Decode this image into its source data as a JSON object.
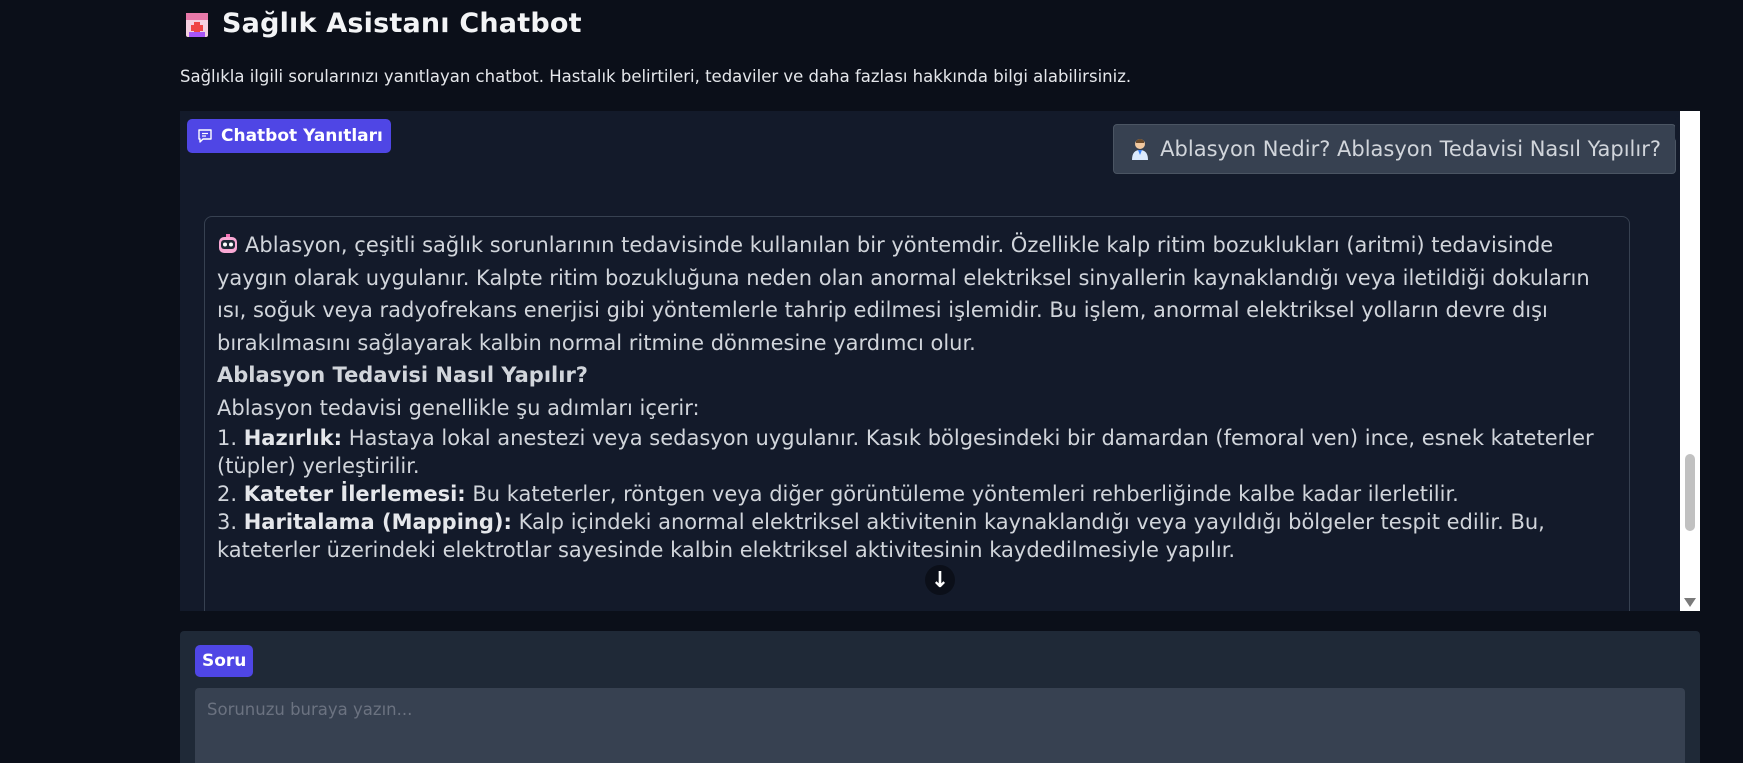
{
  "header": {
    "title_icon": "hospital-icon",
    "title": "Sağlık Asistanı Chatbot",
    "description": "Sağlıkla ilgili sorularınızı yanıtlayan chatbot. Hastalık belirtileri, tedaviler ve daha fazlası hakkında bilgi alabilirsiniz."
  },
  "chat": {
    "label": "Chatbot Yanıtları",
    "label_icon": "chat-icon",
    "clear_icon": "trash-icon",
    "user_message": {
      "avatar_icon": "doctor-icon",
      "text": "Ablasyon Nedir? Ablasyon Tedavisi Nasıl Yapılır?"
    },
    "bot_message": {
      "avatar_icon": "robot-icon",
      "paragraph1": "Ablasyon, çeşitli sağlık sorunlarının tedavisinde kullanılan bir yöntemdir. Özellikle kalp ritim bozuklukları (aritmi) tedavisinde yaygın olarak uygulanır. Kalpte ritim bozukluğuna neden olan anormal elektriksel sinyallerin kaynaklandığı veya iletildiği dokuların ısı, soğuk veya radyofrekans enerjisi gibi yöntemlerle tahrip edilmesi işlemidir. Bu işlem, anormal elektriksel yolların devre dışı bırakılmasını sağlayarak kalbin normal ritmine dönmesine yardımcı olur.",
      "heading": "Ablasyon Tedavisi Nasıl Yapılır?",
      "intro": "Ablasyon tedavisi genellikle şu adımları içerir:",
      "steps": [
        {
          "num": "1.",
          "title": "Hazırlık:",
          "text": "Hastaya lokal anestezi veya sedasyon uygulanır. Kasık bölgesindeki bir damardan (femoral ven) ince, esnek kateterler (tüpler) yerleştirilir."
        },
        {
          "num": "2.",
          "title": "Kateter İlerlemesi:",
          "text": "Bu kateterler, röntgen veya diğer görüntüleme yöntemleri rehberliğinde kalbe kadar ilerletilir."
        },
        {
          "num": "3.",
          "title": "Haritalama (Mapping):",
          "text": "Kalp içindeki anormal elektriksel aktivitenin kaynaklandığı veya yayıldığı bölgeler tespit edilir. Bu, kateterler üzerindeki elektrotlar sayesinde kalbin elektriksel aktivitesinin kaydedilmesiyle yapılır."
        }
      ]
    },
    "scroll_down_glyph": "↓"
  },
  "question": {
    "label": "Soru",
    "placeholder": "Sorunuzu buraya yazın..."
  }
}
